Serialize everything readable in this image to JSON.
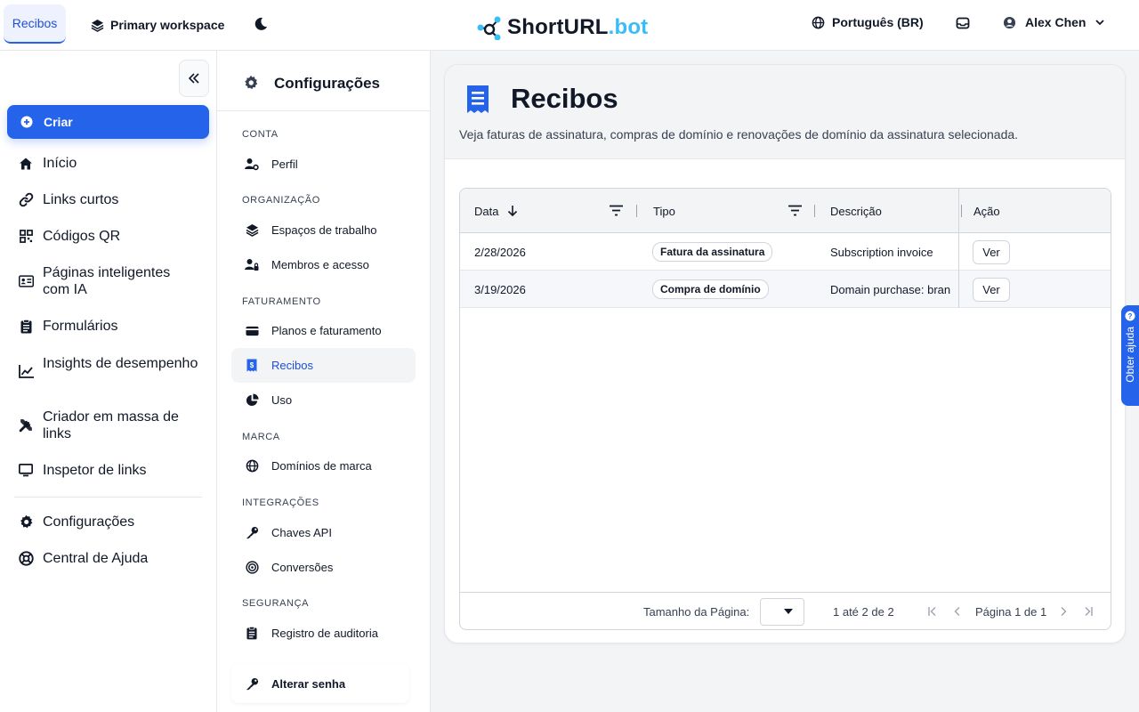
{
  "top": {
    "tab_label": "Recibos",
    "workspace": "Primary workspace",
    "logo_main": "ShortURL",
    "logo_accent": ".bot",
    "language": "Português (BR)",
    "user_name": "Alex Chen"
  },
  "sidebar": {
    "create_label": "Criar",
    "items": [
      {
        "label": "Início",
        "icon": "home-icon"
      },
      {
        "label": "Links curtos",
        "icon": "link-icon"
      },
      {
        "label": "Códigos QR",
        "icon": "qr-code-icon"
      },
      {
        "label": "Páginas inteligentes com IA",
        "icon": "id-card-icon"
      },
      {
        "label": "Formulários",
        "icon": "clipboard-icon"
      },
      {
        "label": "Insights de desempenho",
        "icon": "chart-line-icon"
      },
      {
        "label": "Criador em massa de links",
        "icon": "tools-icon"
      },
      {
        "label": "Inspetor de links",
        "icon": "monitor-icon"
      },
      {
        "label": "Configurações",
        "icon": "gear-icon"
      },
      {
        "label": "Central de Ajuda",
        "icon": "lifebuoy-icon"
      }
    ]
  },
  "settings": {
    "title": "Configurações",
    "sections": {
      "conta": "CONTA",
      "organizacao": "ORGANIZAÇÃO",
      "faturamento": "FATURAMENTO",
      "marca": "MARCA",
      "integracoes": "INTEGRAÇÕES",
      "seguranca": "SEGURANÇA"
    },
    "items": {
      "perfil": "Perfil",
      "espacos": "Espaços de trabalho",
      "membros": "Membros e acesso",
      "planos": "Planos e faturamento",
      "recibos": "Recibos",
      "uso": "Uso",
      "dominios": "Domínios de marca",
      "chaves": "Chaves API",
      "conversoes": "Conversões",
      "registro": "Registro de auditoria",
      "senha": "Alterar senha"
    }
  },
  "main": {
    "title": "Recibos",
    "subtitle": "Veja faturas de assinatura, compras de domínio e renovações de domínio da assinatura selecionada.",
    "columns": {
      "date": "Data",
      "type": "Tipo",
      "description": "Descrição",
      "action": "Ação"
    },
    "rows": [
      {
        "date": "2/28/2026",
        "type": "Fatura da assinatura",
        "description": "Subscription invoice",
        "action": "Ver"
      },
      {
        "date": "3/19/2026",
        "type": "Compra de domínio",
        "description": "Domain purchase: bran",
        "action": "Ver"
      }
    ],
    "footer": {
      "page_size_label": "Tamanho da Página:",
      "range": "1 até 2 de 2",
      "page_info": "Página 1 de 1"
    }
  },
  "help_tab": "Obter ajuda",
  "colors": {
    "primary": "#2563eb",
    "logo_accent": "#38bdf8"
  }
}
